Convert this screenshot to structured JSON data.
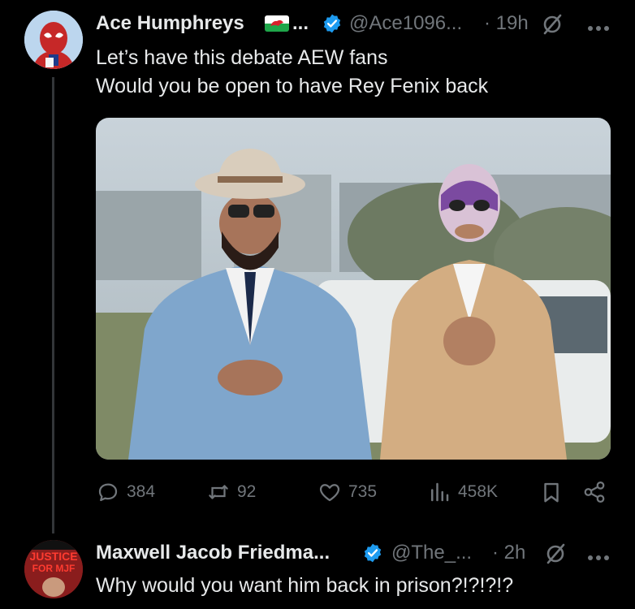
{
  "tweet": {
    "author_name": "Ace Humphreys",
    "ellipsis": "...",
    "handle": "@Ace1096...",
    "time": "· 19h",
    "lines": [
      "Let’s have this debate AEW fans",
      "Would you be open to have Rey Fenix back"
    ],
    "actions": {
      "replies": "384",
      "reposts": "92",
      "likes": "735",
      "views": "458K"
    }
  },
  "reply": {
    "author_name": "Maxwell Jacob Friedma...",
    "handle": "@The_...",
    "time": "· 2h",
    "text": "Why would you want him back in prison?!?!?!?",
    "avatar_text": [
      "JUSTICE",
      "FOR MJF"
    ]
  },
  "icons": {
    "verified": "verified-badge-icon",
    "grok": "grok-icon",
    "more": "more-icon",
    "reply": "reply-icon",
    "repost": "repost-icon",
    "like": "like-icon",
    "views": "views-icon",
    "bookmark": "bookmark-icon",
    "share": "share-icon",
    "flag": "wales-flag-icon"
  },
  "colors": {
    "background": "#000000",
    "text": "#e7e9ea",
    "muted": "#71767b",
    "verified": "#1d9bf0"
  }
}
